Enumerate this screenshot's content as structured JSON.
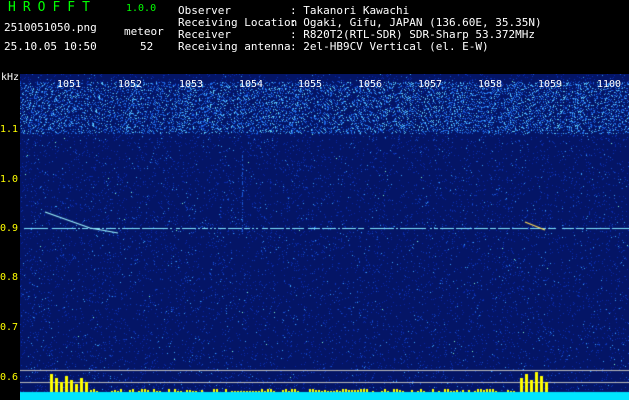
{
  "header": {
    "app_title": "HROFFT",
    "app_version": "1.0.0",
    "file_name": "2510051050.png",
    "timestamp": "25.10.05 10:50",
    "meteor_label": "meteor",
    "meteor_count": "52",
    "info": [
      {
        "key": "Observer",
        "value": ": Takanori Kawachi"
      },
      {
        "key": "Receiving Location",
        "value": ": Ogaki, Gifu, JAPAN (136.60E, 35.35N)"
      },
      {
        "key": "Receiver",
        "value": ": R820T2(RTL-SDR) SDR-Sharp 53.372MHz"
      },
      {
        "key": "Receiving antenna",
        "value": ": 2el-HB9CV Vertical (el. E-W)"
      }
    ]
  },
  "axis": {
    "unit": "kHz",
    "y_ticks": [
      "1.1",
      "1.0",
      "0.9",
      "0.8",
      "0.7",
      "0.6"
    ],
    "x_ticks": [
      "1051",
      "1052",
      "1053",
      "1054",
      "1055",
      "1056",
      "1057",
      "1058",
      "1059",
      "1100"
    ]
  },
  "colors": {
    "background": "#000000",
    "plot_noise_bg": "#061a7a",
    "title_green": "#00ff00",
    "tick_yellow": "#ffff00",
    "signal_cyan": "#00e5ff",
    "meteor_yellow": "#ffff00"
  }
}
